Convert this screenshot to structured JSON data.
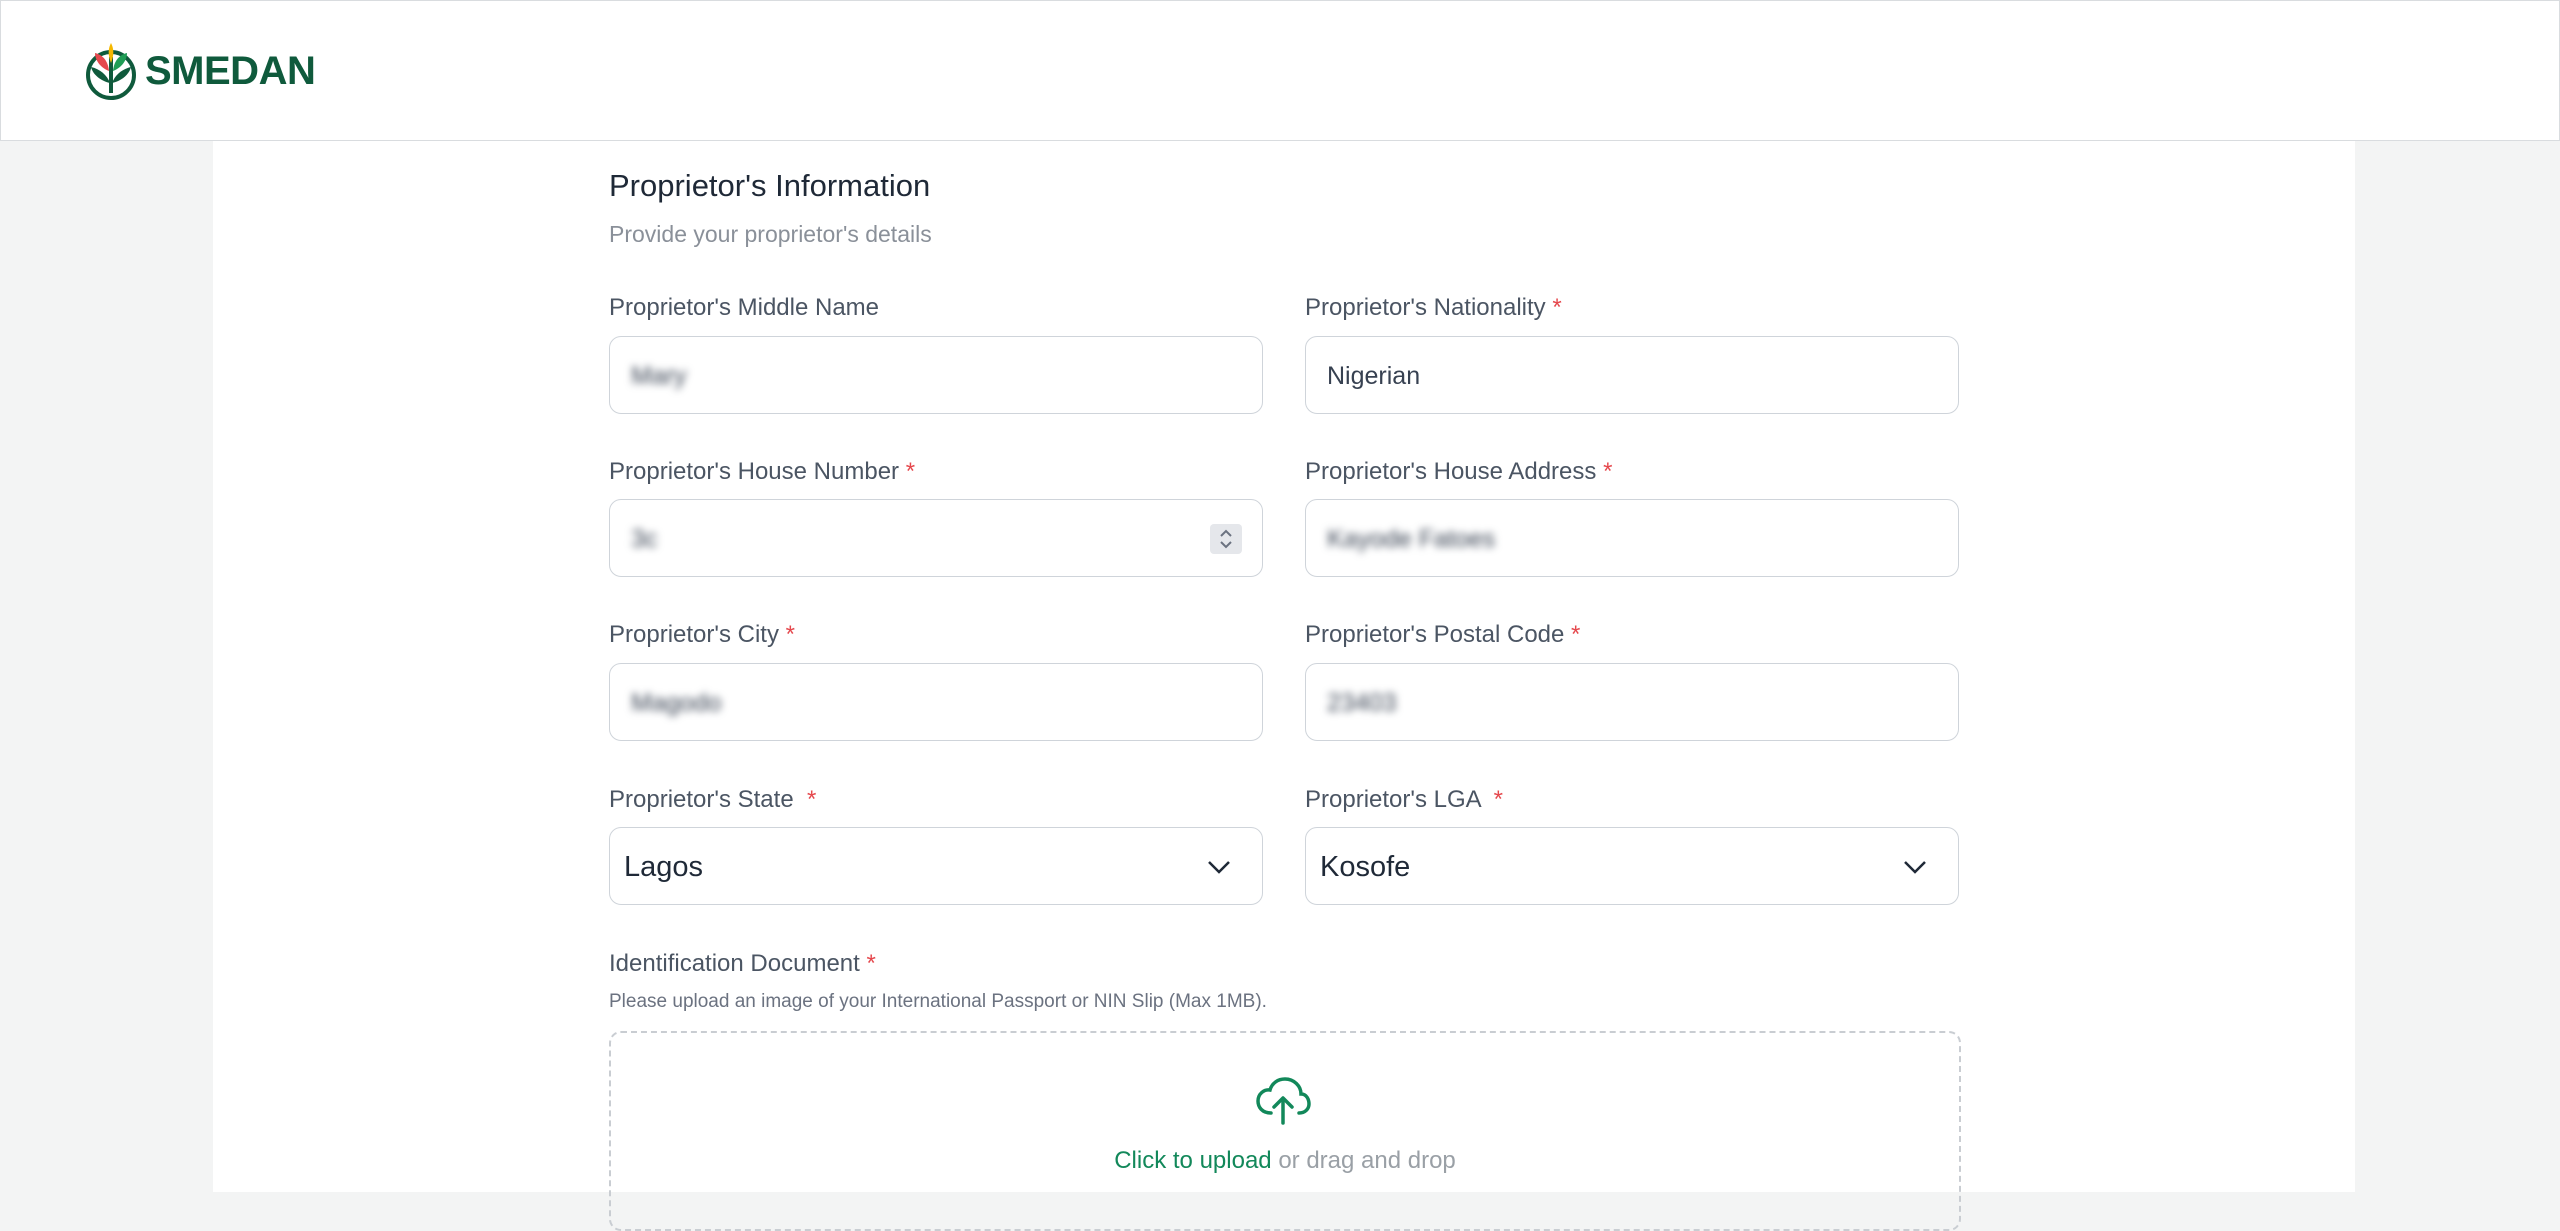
{
  "header": {
    "brand": "SMEDAN",
    "brand_colors": {
      "green": "#0f5a3c",
      "yellow": "#f5b800",
      "red": "#e5484d",
      "leaf_green": "#1f9d55"
    }
  },
  "section": {
    "title": "Proprietor's Information",
    "subtitle": "Provide your proprietor's details"
  },
  "fields": {
    "middle_name": {
      "label": "Proprietor's Middle Name",
      "required": false,
      "value": "Mary"
    },
    "nationality": {
      "label": "Proprietor's Nationality",
      "required": true,
      "value": "Nigerian"
    },
    "house_number": {
      "label": "Proprietor's House Number",
      "required": true,
      "value": "3c"
    },
    "house_address": {
      "label": "Proprietor's House Address",
      "required": true,
      "value": "Kayode Fatoes"
    },
    "city": {
      "label": "Proprietor's City",
      "required": true,
      "value": "Magodo"
    },
    "postal_code": {
      "label": "Proprietor's Postal Code",
      "required": true,
      "value": "23403"
    },
    "state": {
      "label": "Proprietor's State",
      "required": true,
      "value": "Lagos"
    },
    "lga": {
      "label": "Proprietor's LGA",
      "required": true,
      "value": "Kosofe"
    }
  },
  "required_marker": "*",
  "identification": {
    "label": "Identification Document",
    "help": "Please upload an image of your International Passport or NIN Slip (Max 1MB).",
    "upload_link": "Click to upload",
    "upload_rest": "or drag and drop"
  },
  "colors": {
    "accent": "#12885a",
    "required": "#e5484d",
    "page_bg": "#f3f4f4"
  }
}
